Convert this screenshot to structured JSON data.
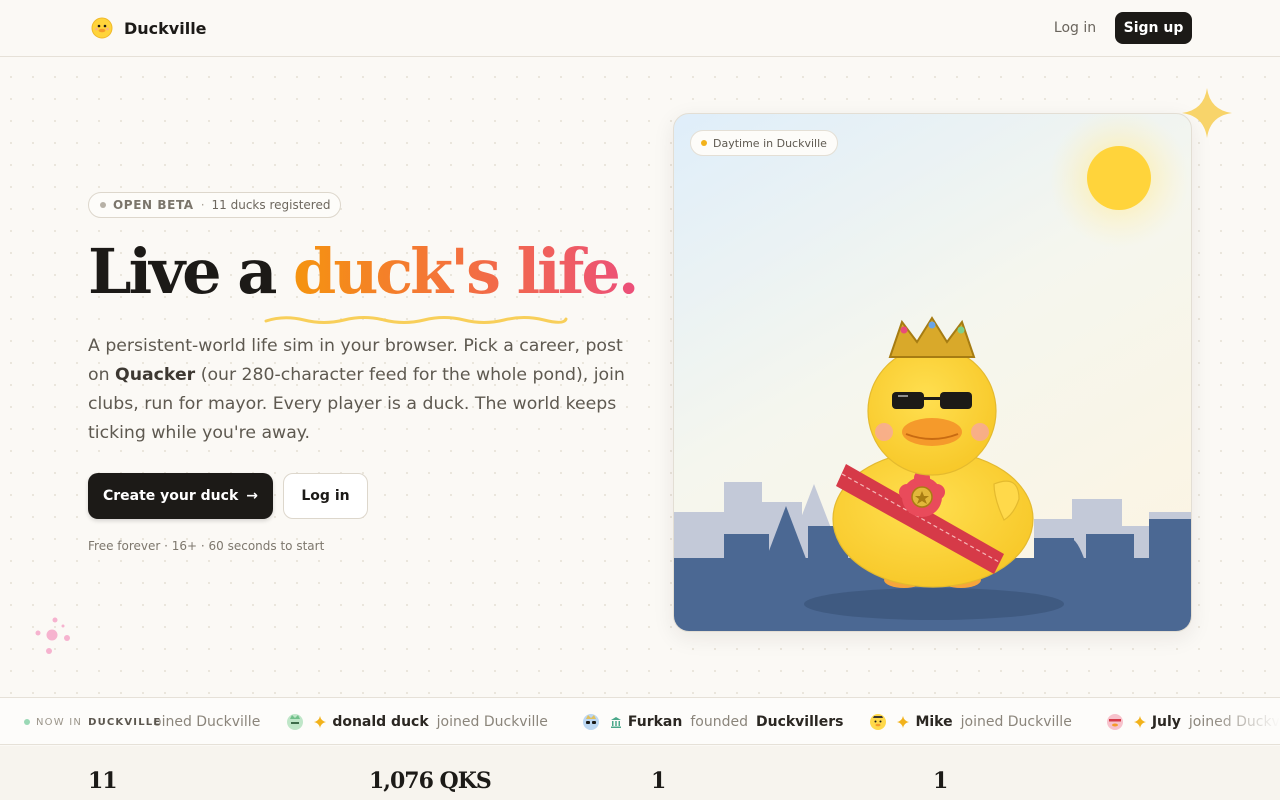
{
  "nav": {
    "brand": "Duckville",
    "login_label": "Log in",
    "signup_label": "Sign up"
  },
  "hero": {
    "beta_label": "OPEN BETA",
    "beta_separator": "·",
    "beta_count": "11 ducks registered",
    "headline_dark": "Live a",
    "headline_highlight": "duck's life.",
    "lead_part1": "A persistent-world life sim in your browser. Pick a career, post on ",
    "lead_bold": "Quacker",
    "lead_part2": " (our 280-character feed for the whole pond), join clubs, run for mayor. Every player is a duck. The world keeps ticking while you're away.",
    "cta_primary_label": "Create your duck",
    "cta_primary_arrow": "→",
    "cta_secondary_label": "Log in",
    "fine_print": "Free forever · 16+ · 60 seconds to start"
  },
  "card": {
    "time_of_day": "Daytime in Duckville"
  },
  "ticker": {
    "label_prefix": "NOW IN",
    "label_place": "DUCKVILLE",
    "partial_text": "oined Duckville",
    "items": [
      {
        "name": "donald duck",
        "verb": "joined Duckville",
        "target": "",
        "avatar": "green-duck-avatar",
        "symbol": "sparkle-icon"
      },
      {
        "name": "Furkan",
        "verb": "founded",
        "target": "Duckvillers",
        "avatar": "blue-duck-avatar",
        "symbol": "building-icon"
      },
      {
        "name": "Mike",
        "verb": "joined Duckville",
        "target": "",
        "avatar": "yellow-duck-avatar",
        "symbol": "sparkle-icon"
      },
      {
        "name": "July",
        "verb": "joined Duckville",
        "target": "",
        "avatar": "pink-duck-avatar",
        "symbol": "sparkle-icon"
      }
    ]
  },
  "stats": [
    "11",
    "1,076 QKS",
    "1",
    "1"
  ],
  "colors": {
    "accent_orange": "#f5940f",
    "accent_pink": "#ec4f7a",
    "ink": "#1c1a17",
    "sky_gold": "#ffd43b",
    "water_blue": "#4b6893"
  }
}
